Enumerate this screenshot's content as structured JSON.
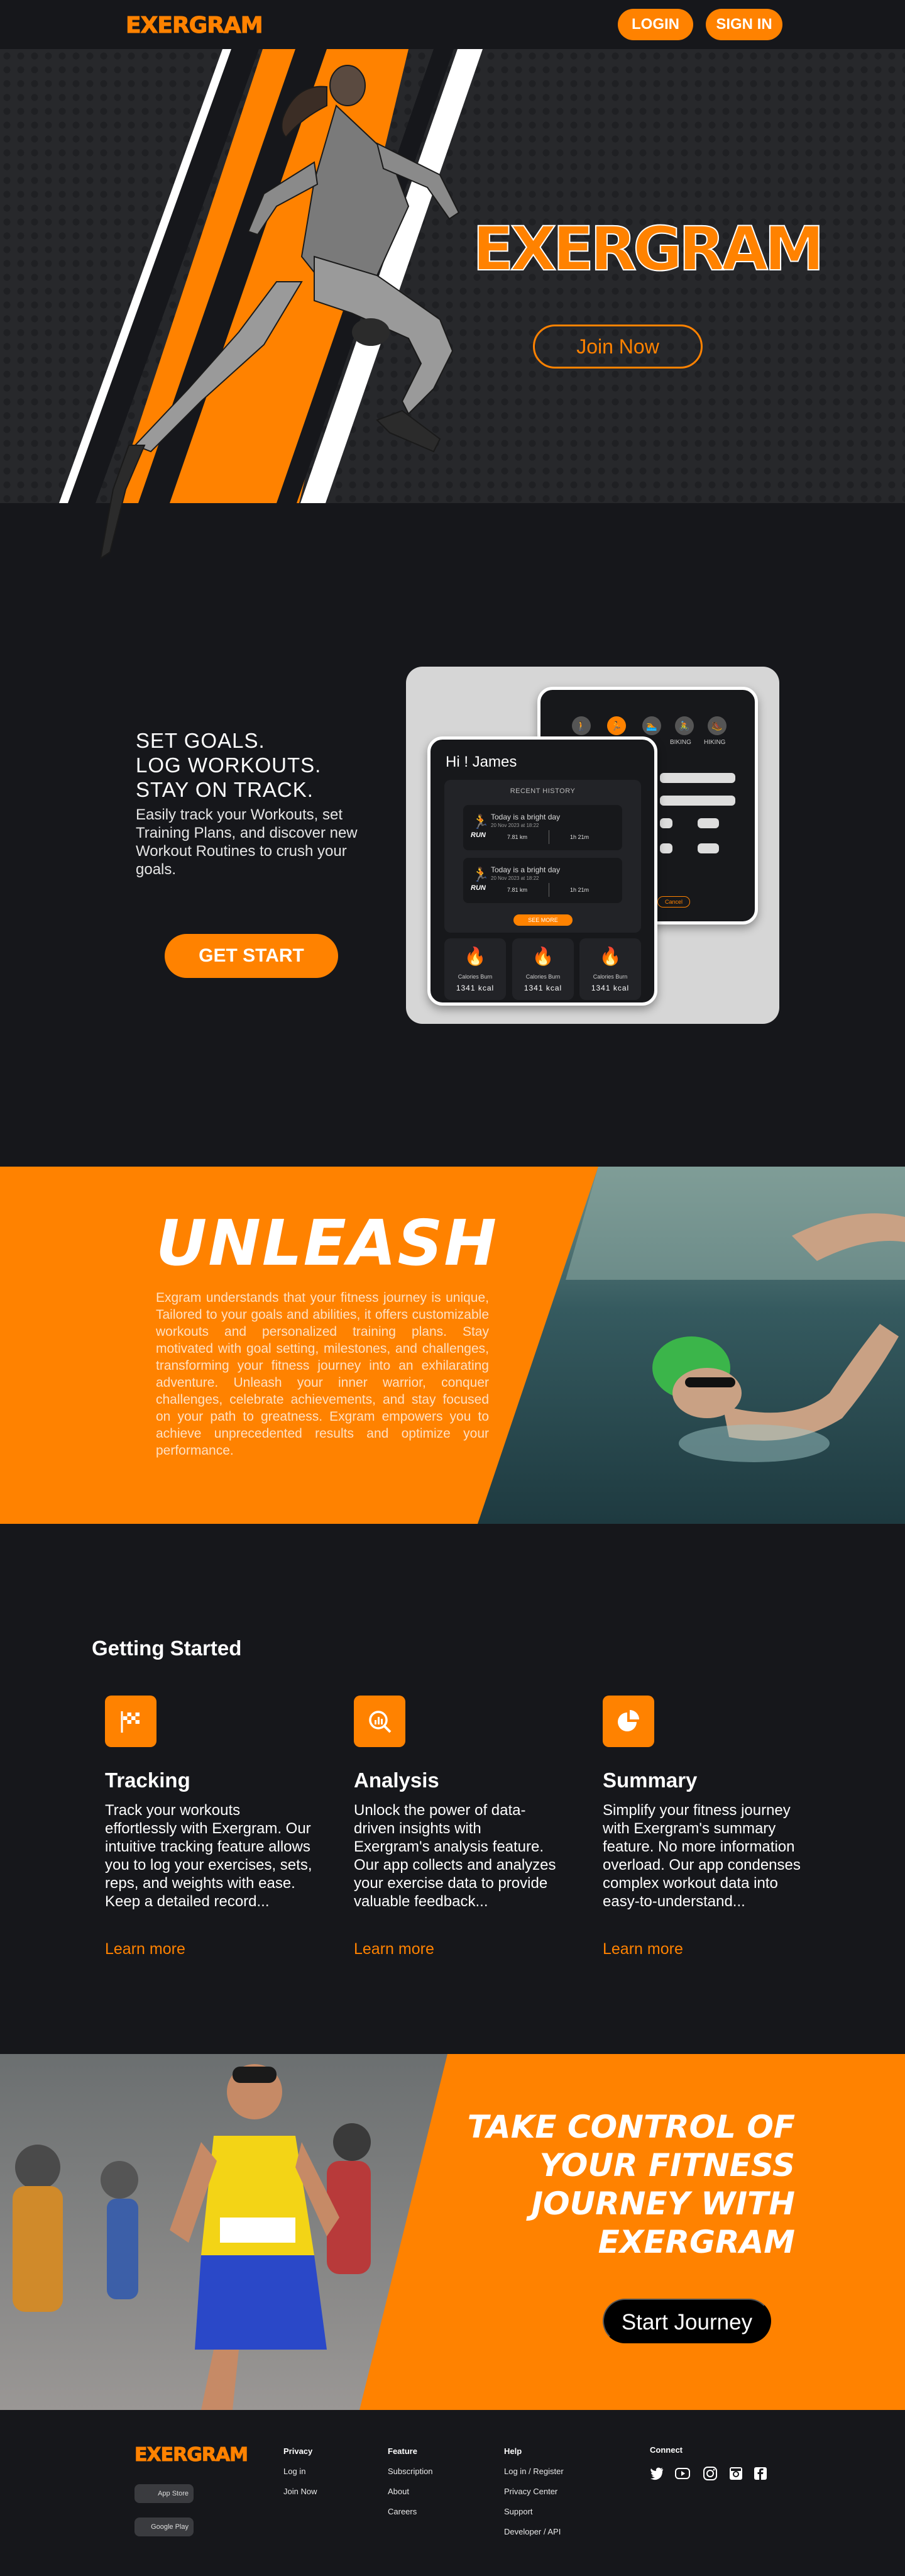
{
  "nav": {
    "logo": "EXERGRAM",
    "login": "LOGIN",
    "signin": "SIGN IN"
  },
  "hero": {
    "title": "EXERGRAM",
    "join": "Join Now"
  },
  "goals": {
    "line1": "SET GOALS.",
    "line2": "LOG WORKOUTS.",
    "line3": "STAY ON TRACK.",
    "body": "Easily track your Workouts, set Training Plans, and discover new Workout Routines to crush your goals.",
    "cta": "GET START"
  },
  "mock": {
    "activities": [
      "BIKING",
      "HIKING"
    ],
    "cancel": "Cancel",
    "greeting": "Hi !  James",
    "recent_title": "RECENT HISTORY",
    "history": [
      {
        "type": "RUN",
        "title": "Today is a bright day",
        "date": "20 Nov 2023 at 18:22",
        "distance": "7.81 km",
        "duration": "1h 21m"
      },
      {
        "type": "RUN",
        "title": "Today is a bright day",
        "date": "20 Nov 2023 at 18:22",
        "distance": "7.81 km",
        "duration": "1h 21m"
      }
    ],
    "see_more": "SEE MORE",
    "calories": [
      {
        "label": "Calories Burn",
        "value": "1341 kcal"
      },
      {
        "label": "Calories Burn",
        "value": "1341 kcal"
      },
      {
        "label": "Calories Burn",
        "value": "1341 kcal"
      }
    ]
  },
  "unleash": {
    "title": "UNLEASH",
    "body": "Exgram understands that your fitness journey is unique, Tailored to your goals and abilities, it offers customizable workouts and personalized training plans. Stay motivated with goal setting, milestones, and challenges, transforming your fitness journey into an exhilarating adventure. Unleash your inner warrior, conquer challenges, celebrate achievements, and stay focused on your path to greatness. Exgram empowers you to achieve unprecedented results and optimize your performance."
  },
  "getting_started": {
    "title": "Getting Started",
    "features": [
      {
        "icon": "checkered-flag-icon",
        "title": "Tracking",
        "body": "Track your workouts effortlessly with Exergram. Our intuitive tracking feature allows you to log your exercises, sets, reps, and weights with ease. Keep a detailed record...",
        "link": "Learn more"
      },
      {
        "icon": "magnifier-chart-icon",
        "title": "Analysis",
        "body": "Unlock the power of data-driven insights with Exergram's analysis feature. Our app collects and analyzes your exercise data to provide valuable feedback...",
        "link": "Learn more"
      },
      {
        "icon": "pie-chart-icon",
        "title": "Summary",
        "body": "Simplify your fitness journey with Exergram's summary feature. No more information overload. Our app condenses complex workout data into easy-to-understand...",
        "link": "Learn more"
      }
    ]
  },
  "take_control": {
    "lines": [
      "TAKE CONTROL OF",
      "YOUR FITNESS",
      "JOURNEY WITH",
      "EXERGRAM"
    ],
    "cta": "Start Journey"
  },
  "footer": {
    "logo": "EXERGRAM",
    "app_store": "App Store",
    "google_play": "Google Play",
    "columns": [
      {
        "title": "Privacy",
        "links": [
          "Log in",
          "Join Now"
        ]
      },
      {
        "title": "Feature",
        "links": [
          "Subscription",
          "About",
          "Careers"
        ]
      },
      {
        "title": "Help",
        "links": [
          "Log in / Register",
          "Privacy Center",
          "Support",
          "Developer / API"
        ]
      }
    ],
    "connect": "Connect",
    "social": [
      "twitter-icon",
      "youtube-icon",
      "instagram-icon",
      "instagram-alt-icon",
      "facebook-icon"
    ]
  },
  "colors": {
    "accent": "#ff8200",
    "background": "#16171b"
  }
}
